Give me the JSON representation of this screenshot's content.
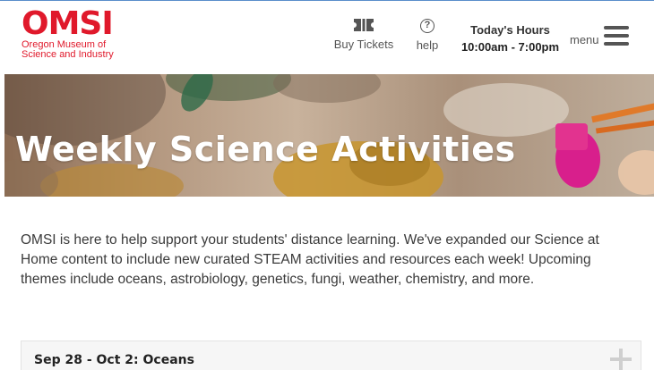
{
  "header": {
    "logo_word": "OMSI",
    "logo_line1": "Oregon Museum of",
    "logo_line2": "Science and Industry",
    "buy_tickets_label": "Buy Tickets",
    "help_label": "help",
    "help_glyph": "?",
    "hours_title": "Today's Hours",
    "hours_value": "10:00am - 7:00pm",
    "menu_label": "menu",
    "brand_color": "#e0192b"
  },
  "hero": {
    "title": "Weekly Science Activities"
  },
  "intro": {
    "text": "OMSI is here to help support your students' distance learning. We've expanded our Science at Home content to include new curated STEAM activities and resources each week! Upcoming themes include oceans, astrobiology, genetics, fungi, weather, chemistry, and more."
  },
  "accordion": {
    "items": [
      {
        "label": "Sep 28 - Oct 2: Oceans",
        "expanded": false
      }
    ]
  }
}
